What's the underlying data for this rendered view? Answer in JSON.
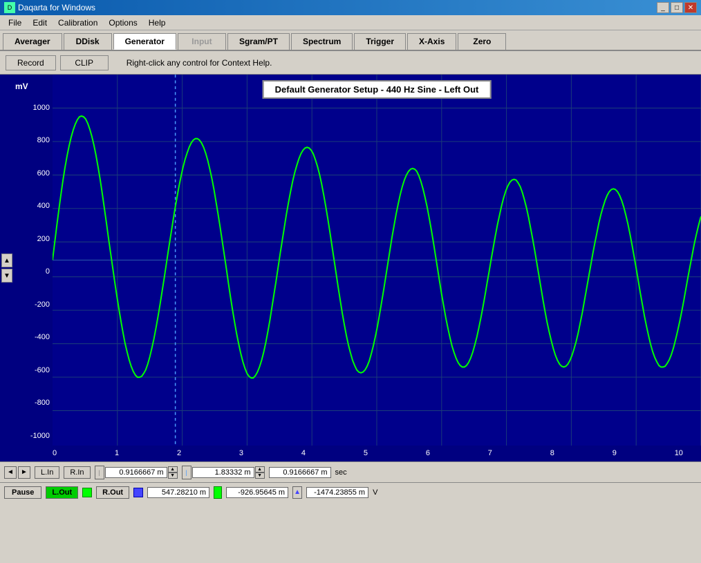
{
  "titleBar": {
    "title": "Daqarta for Windows",
    "buttons": [
      "_",
      "□",
      "✕"
    ]
  },
  "menuBar": {
    "items": [
      "File",
      "Edit",
      "Calibration",
      "Options",
      "Help"
    ]
  },
  "toolbar": {
    "tabs": [
      {
        "label": "Averager",
        "active": false,
        "disabled": false
      },
      {
        "label": "DDisk",
        "active": false,
        "disabled": false
      },
      {
        "label": "Generator",
        "active": true,
        "disabled": false
      },
      {
        "label": "Input",
        "active": false,
        "disabled": true
      },
      {
        "label": "Sgram/PT",
        "active": false,
        "disabled": false
      },
      {
        "label": "Spectrum",
        "active": false,
        "disabled": false
      },
      {
        "label": "Trigger",
        "active": false,
        "disabled": false
      },
      {
        "label": "X-Axis",
        "active": false,
        "disabled": false
      },
      {
        "label": "Zero",
        "active": false,
        "disabled": false
      }
    ]
  },
  "subToolbar": {
    "record_label": "Record",
    "clip_label": "CLIP",
    "help_text": "Right-click any control for Context Help."
  },
  "chart": {
    "yAxisLabel": "mV",
    "yTicks": [
      "1000",
      "800",
      "600",
      "400",
      "200",
      "0",
      "-200",
      "-400",
      "-600",
      "-800",
      "-1000"
    ],
    "xTicks": [
      "0",
      "1",
      "2",
      "3",
      "4",
      "5",
      "6",
      "7",
      "8",
      "9",
      "10"
    ],
    "generatorLabel": "Default Generator Setup - 440 Hz Sine - Left Out"
  },
  "bottomControls": {
    "value1": "0.9166667 m",
    "value2": "1.83332 m",
    "value3": "0.9166667 m",
    "unit": "sec",
    "ch_l_in": "L.In",
    "ch_r_in": "R.In"
  },
  "pauseRow": {
    "pause_label": "Pause",
    "ch_l_out": "L.Out",
    "ch_r_out": "R.Out",
    "value1": "547.28210 m",
    "value2": "-926.95645 m",
    "value3": "-1474.23855 m",
    "unit": "V"
  }
}
